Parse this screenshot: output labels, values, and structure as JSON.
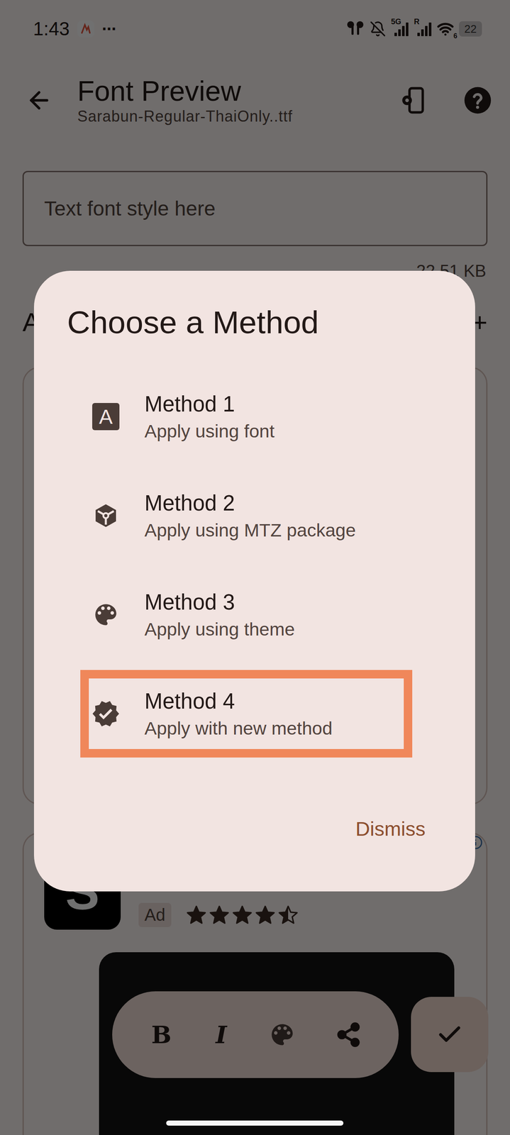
{
  "status_bar": {
    "time": "1:43",
    "more": "···",
    "network": "5G",
    "roaming": "R",
    "wifi": "6",
    "battery": "22"
  },
  "app_bar": {
    "title": "Font Preview",
    "subtitle": "Sarabun-Regular-ThaiOnly..ttf"
  },
  "preview_field": {
    "placeholder": "Text font style here"
  },
  "file_size": "22.51 KB",
  "section": {
    "heading": "A",
    "add": "+"
  },
  "ad": {
    "logo": "S",
    "badge": "Ad",
    "stars": 4.5
  },
  "dialog": {
    "title": "Choose a Method",
    "methods": [
      {
        "name": "Method 1",
        "description": "Apply using font",
        "kind": "font",
        "glyph": "A",
        "highlighted": false
      },
      {
        "name": "Method 2",
        "description": "Apply using MTZ package",
        "kind": "package",
        "highlighted": false
      },
      {
        "name": "Method 3",
        "description": "Apply using theme",
        "kind": "theme",
        "highlighted": false
      },
      {
        "name": "Method 4",
        "description": "Apply with new method",
        "kind": "verified",
        "highlighted": true
      }
    ],
    "dismiss": "Dismiss"
  },
  "toolbar": {
    "bold": "B",
    "italic": "I"
  }
}
